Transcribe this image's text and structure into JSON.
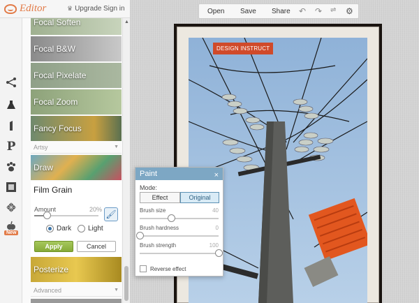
{
  "app": {
    "logo_text": "Editor",
    "upgrade_label": "Upgrade",
    "signin_label": "Sign in"
  },
  "toolbar": {
    "open_label": "Open",
    "save_label": "Save",
    "share_label": "Share",
    "icons": [
      "undo-icon",
      "redo-icon",
      "layers-icon",
      "gear-icon"
    ]
  },
  "tools": [
    {
      "name": "tool-basic-edits",
      "icon": "nodes-icon"
    },
    {
      "name": "tool-effects",
      "icon": "flask-icon",
      "active": true
    },
    {
      "name": "tool-touch-up",
      "icon": "lipstick-icon"
    },
    {
      "name": "tool-text",
      "icon": "text-p-icon"
    },
    {
      "name": "tool-overlays",
      "icon": "paw-icon"
    },
    {
      "name": "tool-frames",
      "icon": "frame-icon"
    },
    {
      "name": "tool-textures",
      "icon": "diamond-grid-icon"
    },
    {
      "name": "tool-seasonal",
      "icon": "apple-icon",
      "badge": "New"
    }
  ],
  "effects": {
    "focal_soften": "Focal Soften",
    "focal_bw": "Focal B&W",
    "focal_pixelate": "Focal Pixelate",
    "focal_zoom": "Focal Zoom",
    "fancy_focus": "Fancy Focus",
    "section_artsy": "Artsy",
    "draw": "Draw",
    "posterize": "Posterize",
    "section_advanced": "Advanced"
  },
  "film_grain": {
    "title": "Film Grain",
    "amount_label": "Amount",
    "amount_value": "20%",
    "amount_fraction": 0.2,
    "dark_label": "Dark",
    "light_label": "Light",
    "selected": "Dark",
    "apply_label": "Apply",
    "cancel_label": "Cancel"
  },
  "photo": {
    "tag": "DESIGN INSTRUCT"
  },
  "paint": {
    "title": "Paint",
    "close_label": "×",
    "mode_label": "Mode:",
    "mode_effect": "Effect",
    "mode_original": "Original",
    "mode_selected": "Original",
    "brush_size_label": "Brush size",
    "brush_size_value": "40",
    "brush_size_fraction": 0.4,
    "brush_hardness_label": "Brush hardness",
    "brush_hardness_value": "0",
    "brush_hardness_fraction": 0,
    "brush_strength_label": "Brush strength",
    "brush_strength_value": "100",
    "brush_strength_fraction": 1,
    "reverse_label": "Reverse effect",
    "reverse_checked": false
  }
}
